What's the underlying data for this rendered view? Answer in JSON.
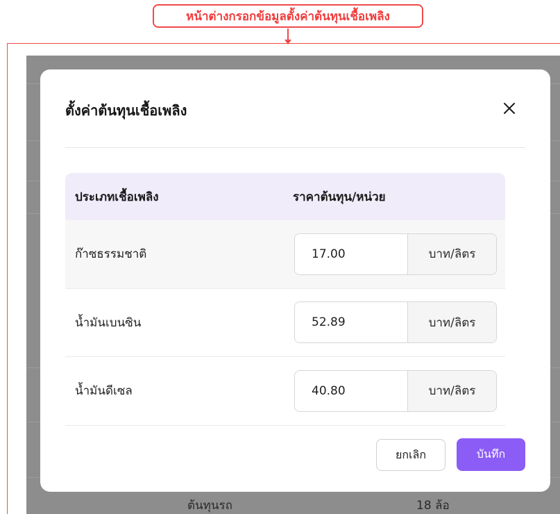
{
  "annotation": {
    "label": "หน้าต่างกรอกข้อมูลตั้งค่าต้นทุนเชื้อเพลิง"
  },
  "background": {
    "row_label": "ต้นทุนรถ",
    "row_value": "18 ล้อ"
  },
  "modal": {
    "title": "ตั้งค่าต้นทุนเชื้อเพลิง",
    "close_icon": "close-icon",
    "table": {
      "headers": {
        "type": "ประเภทเชื้อเพลิง",
        "cost": "ราคาต้นทุน/หน่วย"
      },
      "rows": [
        {
          "type": "ก๊าซธรรมชาติ",
          "value": "17.00",
          "unit": "บาท/ลิตร"
        },
        {
          "type": "น้ำมันเบนซิน",
          "value": "52.89",
          "unit": "บาท/ลิตร"
        },
        {
          "type": "น้ำมันดีเซล",
          "value": "40.80",
          "unit": "บาท/ลิตร"
        }
      ]
    },
    "buttons": {
      "cancel": "ยกเลิก",
      "save": "บันทึก"
    }
  },
  "colors": {
    "accent": "#8b5cf6",
    "header_bg": "#f0ecfa",
    "annotation": "#f04a4a",
    "backdrop": "#8d8d8d"
  }
}
